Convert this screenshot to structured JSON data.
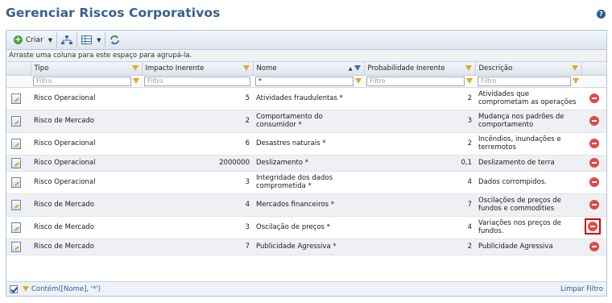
{
  "page": {
    "title": "Gerenciar Riscos Corporativos",
    "help_icon": "help-icon"
  },
  "toolbar": {
    "create_label": "Criar",
    "icons": [
      "add-icon",
      "hierarchy-icon",
      "grid-icon",
      "refresh-icon"
    ]
  },
  "grid": {
    "group_hint": "Arraste uma coluna para este espaço para agrupá-la.",
    "columns": [
      "Tipo",
      "Impacto Inerente",
      "Nome",
      "Probabilidade Inerente",
      "Descrição"
    ],
    "filters": {
      "tipo": "Filtro",
      "impacto": "Filtro",
      "nome": "*",
      "probabilidade": "Filtro",
      "descricao": "Filtro"
    },
    "rows": [
      {
        "tipo": "Risco Operacional",
        "impacto": "5",
        "nome": "Atividades fraudulentas *",
        "probabilidade": "2",
        "descricao": "Atividades que comprometam as operações"
      },
      {
        "tipo": "Risco de Mercado",
        "impacto": "2",
        "nome": "Comportamento do consumidor *",
        "probabilidade": "3",
        "descricao": "Mudança nos padrões de comportamento"
      },
      {
        "tipo": "Risco Operacional",
        "impacto": "6",
        "nome": "Desastres naturais *",
        "probabilidade": "2",
        "descricao": "Incêndios, inundações e terremotos"
      },
      {
        "tipo": "Risco Operacional",
        "impacto": "2000000",
        "nome": "Deslizamento *",
        "probabilidade": "0,1",
        "descricao": "Deslizamento de terra"
      },
      {
        "tipo": "Risco Operacional",
        "impacto": "3",
        "nome": "Integridade dos dados comprometida *",
        "probabilidade": "4",
        "descricao": "Dados corrompidos."
      },
      {
        "tipo": "Risco de Mercado",
        "impacto": "4",
        "nome": "Mercados financeiros *",
        "probabilidade": "7",
        "descricao": "Oscilações de preços de fundos e commodities"
      },
      {
        "tipo": "Risco de Mercado",
        "impacto": "3",
        "nome": "Oscilação de preços *",
        "probabilidade": "4",
        "descricao": "Variações nos preços de fundos."
      },
      {
        "tipo": "Risco de Mercado",
        "impacto": "7",
        "nome": "Publicidade Agressiva *",
        "probabilidade": "2",
        "descricao": "Publicidade Agressiva"
      }
    ]
  },
  "footer": {
    "filter_text": "Contém([Nome], '*')",
    "clear_label": "Limpar Filtro"
  }
}
